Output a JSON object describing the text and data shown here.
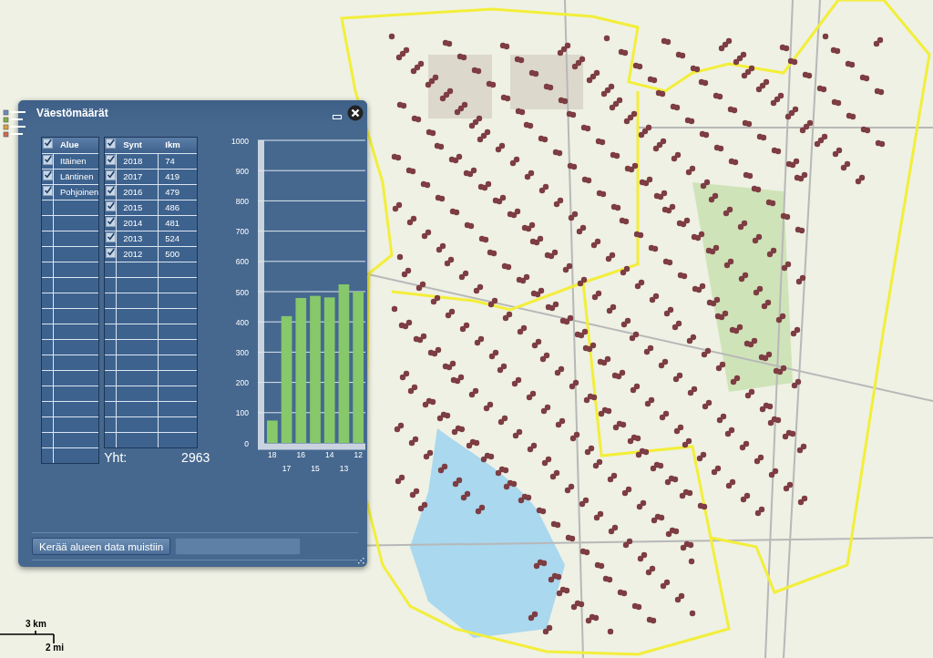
{
  "window": {
    "title": "Väestömäärät"
  },
  "areas_table": {
    "column": "Alue",
    "header_checked": true,
    "rows": [
      {
        "name": "Itäinen",
        "checked": true
      },
      {
        "name": "Läntinen",
        "checked": true
      },
      {
        "name": "Pohjoinen",
        "checked": true
      }
    ]
  },
  "births_table": {
    "columns": [
      "Synt",
      "Ikm"
    ],
    "header_checked": true,
    "rows": [
      {
        "year": "2018",
        "count": "74",
        "checked": true
      },
      {
        "year": "2017",
        "count": "419",
        "checked": true
      },
      {
        "year": "2016",
        "count": "479",
        "checked": true
      },
      {
        "year": "2015",
        "count": "486",
        "checked": true
      },
      {
        "year": "2014",
        "count": "481",
        "checked": true
      },
      {
        "year": "2013",
        "count": "524",
        "checked": true
      },
      {
        "year": "2012",
        "count": "500",
        "checked": true
      }
    ]
  },
  "total": {
    "label": "Yht:",
    "value": "2963"
  },
  "chart_data": {
    "type": "bar",
    "categories": [
      "18",
      "17",
      "16",
      "15",
      "14",
      "13",
      "12"
    ],
    "grid": true,
    "series": [
      {
        "color": "#86c86a",
        "values": [
          74,
          419,
          479,
          486,
          481,
          524,
          500
        ]
      }
    ],
    "ylim": [
      0,
      1000
    ],
    "yticks": [
      0,
      100,
      200,
      300,
      400,
      500,
      600,
      700,
      800,
      900,
      1000
    ]
  },
  "buttons": [
    {
      "label": "Kerää alueen data muistiin",
      "disabled": false
    },
    {
      "disabled": true
    }
  ],
  "scale_bar": {
    "metric": "3 km",
    "imperial": "2 mi"
  }
}
